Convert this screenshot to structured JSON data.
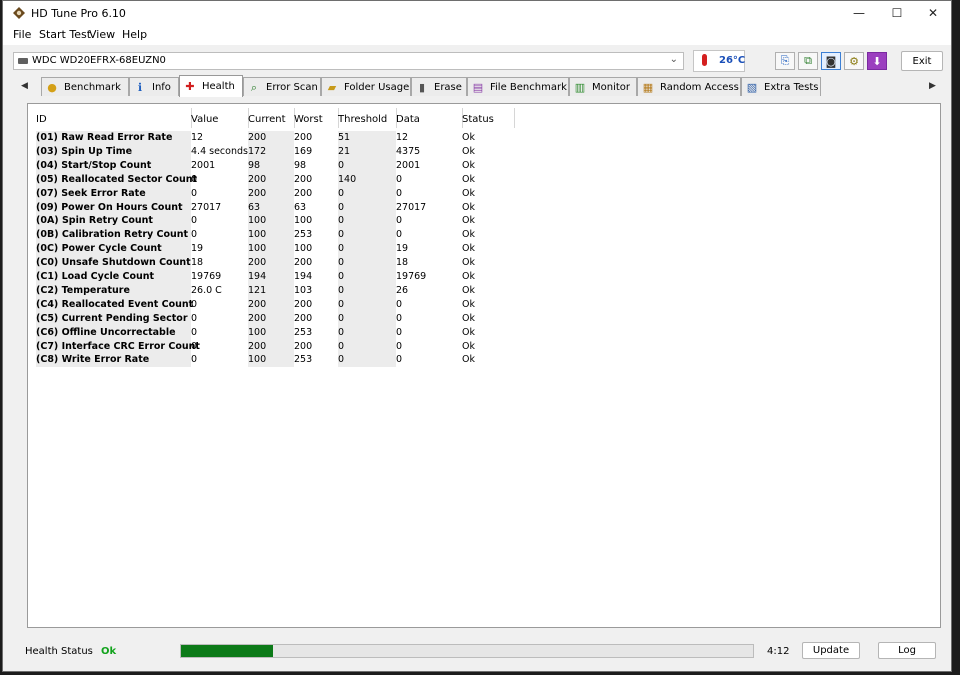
{
  "window": {
    "title": "HD Tune Pro 6.10",
    "minimize_glyph": "—",
    "maximize_glyph": "☐",
    "close_glyph": "✕"
  },
  "menu": [
    "File",
    "Start Test",
    "View",
    "Help"
  ],
  "toolbar": {
    "drive": "WDC WD20EFRX-68EUZN0",
    "temperature": "26°C",
    "exit_label": "Exit",
    "buttons": [
      {
        "icon": "copy-text-icon",
        "glyph": "⎘"
      },
      {
        "icon": "copy-info-icon",
        "glyph": "⧉"
      },
      {
        "icon": "camera-icon",
        "glyph": "◙"
      },
      {
        "icon": "settings-icon",
        "glyph": "⚙"
      },
      {
        "icon": "save-icon",
        "glyph": "⬇"
      }
    ]
  },
  "tabs": [
    {
      "label": "Benchmark",
      "icon": "benchmark-icon",
      "glyph": "●",
      "color": "#d4a017"
    },
    {
      "label": "Info",
      "icon": "info-icon",
      "glyph": "ℹ",
      "color": "#1f5fbf"
    },
    {
      "label": "Health",
      "icon": "health-icon",
      "glyph": "✚",
      "color": "#d21f1f",
      "active": true
    },
    {
      "label": "Error Scan",
      "icon": "magnifier-icon",
      "glyph": "⌕",
      "color": "#2a7d2a"
    },
    {
      "label": "Folder Usage",
      "icon": "folder-icon",
      "glyph": "▰",
      "color": "#c79a1a"
    },
    {
      "label": "Erase",
      "icon": "trash-icon",
      "glyph": "▮",
      "color": "#555555"
    },
    {
      "label": "File Benchmark",
      "icon": "file-benchmark-icon",
      "glyph": "▤",
      "color": "#8a3fa8"
    },
    {
      "label": "Monitor",
      "icon": "monitor-icon",
      "glyph": "▥",
      "color": "#2e8b2e"
    },
    {
      "label": "Random Access",
      "icon": "random-access-icon",
      "glyph": "▦",
      "color": "#b57a1a"
    },
    {
      "label": "Extra Tests",
      "icon": "extra-tests-icon",
      "glyph": "▧",
      "color": "#2f5fa8"
    }
  ],
  "health_table": {
    "headers": [
      "ID",
      "Value",
      "Current",
      "Worst",
      "Threshold",
      "Data",
      "Status"
    ],
    "rows": [
      [
        "(01) Raw Read Error Rate",
        "12",
        "200",
        "200",
        "51",
        "12",
        "Ok"
      ],
      [
        "(03) Spin Up Time",
        "4.4 seconds",
        "172",
        "169",
        "21",
        "4375",
        "Ok"
      ],
      [
        "(04) Start/Stop Count",
        "2001",
        "98",
        "98",
        "0",
        "2001",
        "Ok"
      ],
      [
        "(05) Reallocated Sector Count",
        "0",
        "200",
        "200",
        "140",
        "0",
        "Ok"
      ],
      [
        "(07) Seek Error Rate",
        "0",
        "200",
        "200",
        "0",
        "0",
        "Ok"
      ],
      [
        "(09) Power On Hours Count",
        "27017",
        "63",
        "63",
        "0",
        "27017",
        "Ok"
      ],
      [
        "(0A) Spin Retry Count",
        "0",
        "100",
        "100",
        "0",
        "0",
        "Ok"
      ],
      [
        "(0B) Calibration Retry Count",
        "0",
        "100",
        "253",
        "0",
        "0",
        "Ok"
      ],
      [
        "(0C) Power Cycle Count",
        "19",
        "100",
        "100",
        "0",
        "19",
        "Ok"
      ],
      [
        "(C0) Unsafe Shutdown Count",
        "18",
        "200",
        "200",
        "0",
        "18",
        "Ok"
      ],
      [
        "(C1) Load Cycle Count",
        "19769",
        "194",
        "194",
        "0",
        "19769",
        "Ok"
      ],
      [
        "(C2) Temperature",
        "26.0 C",
        "121",
        "103",
        "0",
        "26",
        "Ok"
      ],
      [
        "(C4) Reallocated Event Count",
        "0",
        "200",
        "200",
        "0",
        "0",
        "Ok"
      ],
      [
        "(C5) Current Pending Sector",
        "0",
        "200",
        "200",
        "0",
        "0",
        "Ok"
      ],
      [
        "(C6) Offline Uncorrectable",
        "0",
        "100",
        "253",
        "0",
        "0",
        "Ok"
      ],
      [
        "(C7) Interface CRC Error Count",
        "0",
        "200",
        "200",
        "0",
        "0",
        "Ok"
      ],
      [
        "(C8) Write Error Rate",
        "0",
        "100",
        "253",
        "0",
        "0",
        "Ok"
      ]
    ]
  },
  "status": {
    "label": "Health Status",
    "value": "Ok",
    "value_color": "#12a31c",
    "progress_fraction": 0.16,
    "time": "4:12",
    "update_label": "Update",
    "log_label": "Log"
  }
}
